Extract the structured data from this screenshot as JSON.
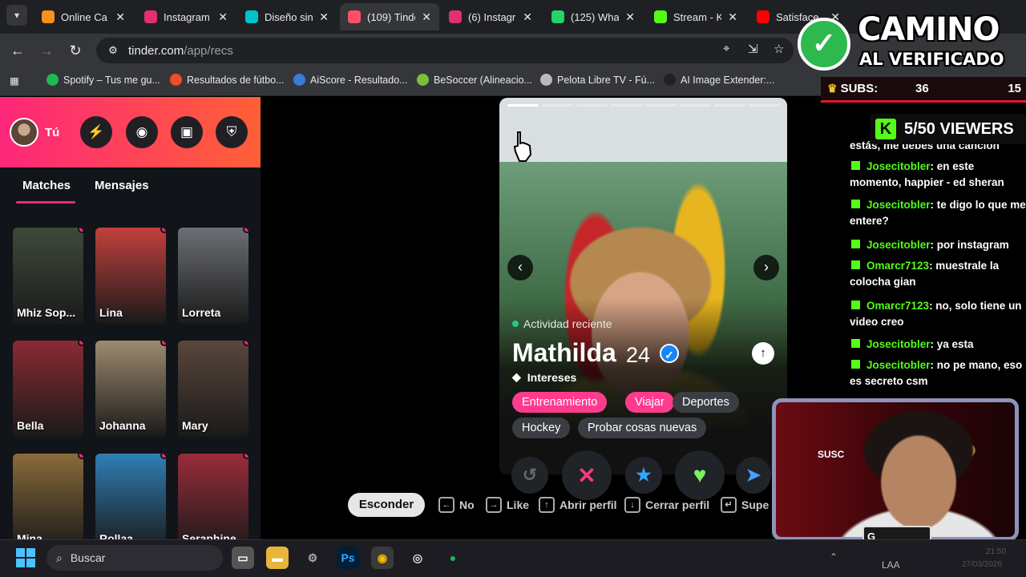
{
  "browser": {
    "tabs": [
      {
        "title": "Online Ca",
        "favicon": "bitcoin-orange",
        "color": "#f7931a"
      },
      {
        "title": "Instagram",
        "favicon": "instagram",
        "color": "#e1306c"
      },
      {
        "title": "Diseño sin",
        "favicon": "canva",
        "color": "#00c4cc"
      },
      {
        "title": "(109) Tinde",
        "favicon": "tinder",
        "color": "#fd5068"
      },
      {
        "title": "(6) Instagr",
        "favicon": "instagram",
        "color": "#e1306c"
      },
      {
        "title": "(125) Wha",
        "favicon": "whatsapp",
        "color": "#25d366"
      },
      {
        "title": "Stream - K",
        "favicon": "kick",
        "color": "#53fc18"
      },
      {
        "title": "Satisface",
        "favicon": "youtube",
        "color": "#ff0000"
      }
    ],
    "url_host": "tinder.com",
    "url_path": "/app/recs",
    "bookmarks": [
      {
        "label": "Spotify – Tus me gu...",
        "color": "#1db954"
      },
      {
        "label": "Resultados de fútbo...",
        "color": "#f04e23"
      },
      {
        "label": "AiScore - Resultado...",
        "color": "#3a7bd5"
      },
      {
        "label": "BeSoccer (Alineacio...",
        "color": "#7bbf3b"
      },
      {
        "label": "Pelota Libre TV - Fú...",
        "color": "#bbbbbb"
      },
      {
        "label": "AI Image Extender:...",
        "color": "#222222"
      }
    ]
  },
  "tinder": {
    "me_label": "Tú",
    "tabs": {
      "matches": "Matches",
      "messages": "Mensajes"
    },
    "matches": [
      {
        "name": "Mhiz Sop...",
        "bg": "#3f4a3a"
      },
      {
        "name": "Lina",
        "bg": "#c2413d"
      },
      {
        "name": "Lorreta",
        "bg": "#6c6f74"
      },
      {
        "name": "Bella",
        "bg": "#8a2b34"
      },
      {
        "name": "Johanna",
        "bg": "#9d8b70"
      },
      {
        "name": "Mary",
        "bg": "#5a463c"
      },
      {
        "name": "Mina",
        "bg": "#8a6a3a"
      },
      {
        "name": "Rollaa",
        "bg": "#2f7fb5"
      },
      {
        "name": "Seraphine",
        "bg": "#9b2c3a"
      }
    ],
    "profile": {
      "activity": "Actividad reciente",
      "name": "Mathilda",
      "age": "24",
      "interests_label": "Intereses",
      "interests": [
        "Entrenamiento",
        "Viajar",
        "Deportes",
        "Hockey",
        "Probar cosas nuevas"
      ],
      "shared_interests": [
        "Entrenamiento",
        "Viajar"
      ]
    },
    "shortcuts": {
      "hide": "Esconder",
      "no": "No",
      "like": "Like",
      "open": "Abrir perfil",
      "close": "Cerrar perfil",
      "super": "Supe"
    }
  },
  "overlay": {
    "title_line1": "CAMINO",
    "title_line2": "AL VERIFICADO",
    "subs_label": "SUBS:",
    "subs_current": "36",
    "subs_goal": "15",
    "viewers": "5/50 VIEWERS",
    "chat": [
      {
        "user": "",
        "text": "estás, me debes una canción"
      },
      {
        "user": "Josecitobler",
        "text": ": en este momento, happier - ed sheran"
      },
      {
        "user": "Josecitobler",
        "text": ": te digo lo que me entere?"
      },
      {
        "user": "Josecitobler",
        "text": ": por instagram"
      },
      {
        "user": "Omarcr7123",
        "text": ": muestrale la colocha gian"
      },
      {
        "user": "Omarcr7123",
        "text": ": no, solo tiene un video creo"
      },
      {
        "user": "Josecitobler",
        "text": ": ya esta"
      },
      {
        "user": "Josecitobler",
        "text": ": no pe mano, eso es secreto csm"
      }
    ],
    "cam_sign": "SUSC",
    "cam_tag": "G"
  },
  "taskbar": {
    "search_placeholder": "Buscar",
    "tray_lang": "LAA",
    "time": "21:50",
    "date": "27/03/2026"
  }
}
